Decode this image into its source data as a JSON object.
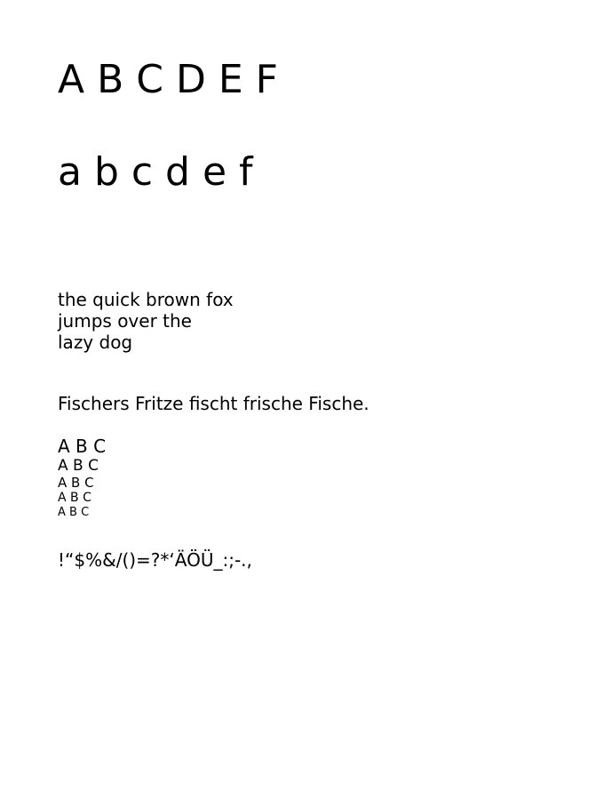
{
  "document": {
    "uppercase_line": "A B C D E F",
    "lowercase_line": "a b c d e f",
    "pangram_lines": [
      "the quick brown fox",
      "jumps over the",
      "lazy dog"
    ],
    "german_sentence": "Fischers Fritze fischt frische Fische.",
    "size_samples": [
      "A B C",
      "A B C",
      "A B C",
      "A B C",
      "A B C"
    ],
    "special_chars": "!“$%&/()=?*‘ÄÖÜ_:;-.,"
  }
}
